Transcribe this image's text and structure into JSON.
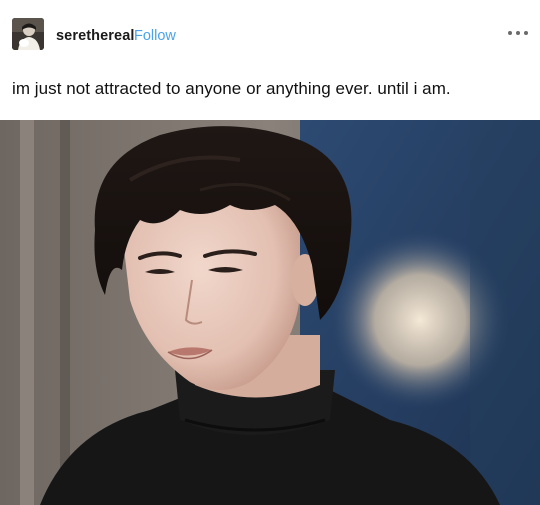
{
  "post": {
    "username": "serethereal",
    "follow_label": "Follow",
    "more_icon": "more-horizontal-icon",
    "text": "im just not attracted to anyone or anything ever. until i am."
  },
  "colors": {
    "follow": "#4aa3ea",
    "background": "#ffffff",
    "text": "#111111"
  }
}
